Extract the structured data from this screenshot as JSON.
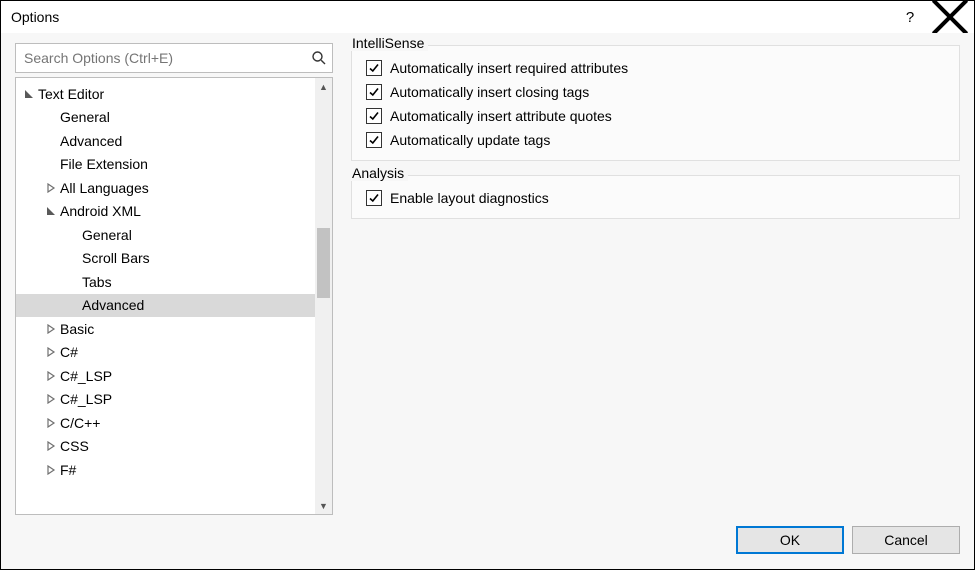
{
  "window": {
    "title": "Options"
  },
  "search": {
    "placeholder": "Search Options (Ctrl+E)"
  },
  "tree": {
    "items": [
      {
        "label": "Text Editor",
        "indent": 0,
        "expander": "expanded"
      },
      {
        "label": "General",
        "indent": 1,
        "expander": "none"
      },
      {
        "label": "Advanced",
        "indent": 1,
        "expander": "none"
      },
      {
        "label": "File Extension",
        "indent": 1,
        "expander": "none"
      },
      {
        "label": "All Languages",
        "indent": 1,
        "expander": "collapsed"
      },
      {
        "label": "Android XML",
        "indent": 1,
        "expander": "expanded"
      },
      {
        "label": "General",
        "indent": 2,
        "expander": "none"
      },
      {
        "label": "Scroll Bars",
        "indent": 2,
        "expander": "none"
      },
      {
        "label": "Tabs",
        "indent": 2,
        "expander": "none"
      },
      {
        "label": "Advanced",
        "indent": 2,
        "expander": "none",
        "selected": true
      },
      {
        "label": "Basic",
        "indent": 1,
        "expander": "collapsed"
      },
      {
        "label": "C#",
        "indent": 1,
        "expander": "collapsed"
      },
      {
        "label": "C#_LSP",
        "indent": 1,
        "expander": "collapsed"
      },
      {
        "label": "C#_LSP",
        "indent": 1,
        "expander": "collapsed"
      },
      {
        "label": "C/C++",
        "indent": 1,
        "expander": "collapsed"
      },
      {
        "label": "CSS",
        "indent": 1,
        "expander": "collapsed"
      },
      {
        "label": "F#",
        "indent": 1,
        "expander": "collapsed"
      }
    ]
  },
  "groups": {
    "intellisense": {
      "label": "IntelliSense",
      "checks": [
        {
          "label": "Automatically insert required attributes",
          "checked": true
        },
        {
          "label": "Automatically insert closing tags",
          "checked": true
        },
        {
          "label": "Automatically insert attribute quotes",
          "checked": true
        },
        {
          "label": "Automatically update tags",
          "checked": true
        }
      ]
    },
    "analysis": {
      "label": "Analysis",
      "checks": [
        {
          "label": "Enable layout diagnostics",
          "checked": true
        }
      ]
    }
  },
  "buttons": {
    "ok": "OK",
    "cancel": "Cancel"
  }
}
